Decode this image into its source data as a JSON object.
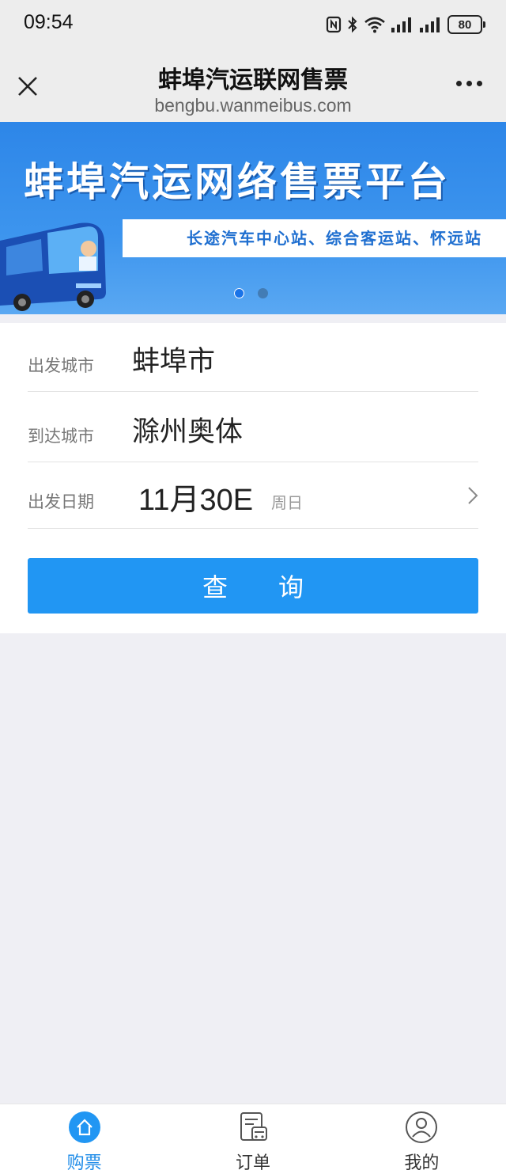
{
  "status_bar": {
    "time": "09:54",
    "battery": "80",
    "icons": [
      "nfc-icon",
      "bluetooth-icon",
      "wifi-icon",
      "signal-icon",
      "signal-icon",
      "battery-icon"
    ]
  },
  "title_bar": {
    "title": "蚌埠汽运联网售票",
    "url": "bengbu.wanmeibus.com",
    "close_icon": "close-icon",
    "more_icon": "more-icon"
  },
  "banner": {
    "headline": "蚌埠汽运网络售票平台",
    "subtitle": "长途汽车中心站、综合客运站、怀远站",
    "slide_count": 2,
    "active_slide": 1,
    "colors": {
      "background": "#3d95ee",
      "accent": "#1f6fd0"
    }
  },
  "form": {
    "departure_label": "出发城市",
    "departure_value": "蚌埠市",
    "arrival_label": "到达城市",
    "arrival_value": "滁州奥体",
    "date_label": "出发日期",
    "date_value": "11月30E",
    "weekday": "周日",
    "search_label": "查　　询",
    "search_color": "#2196f3"
  },
  "tabbar": {
    "tabs": [
      {
        "label": "购票",
        "icon": "home-icon",
        "active": true
      },
      {
        "label": "订单",
        "icon": "order-icon",
        "active": false
      },
      {
        "label": "我的",
        "icon": "user-icon",
        "active": false
      }
    ],
    "active_color": "#1f8ce8"
  }
}
